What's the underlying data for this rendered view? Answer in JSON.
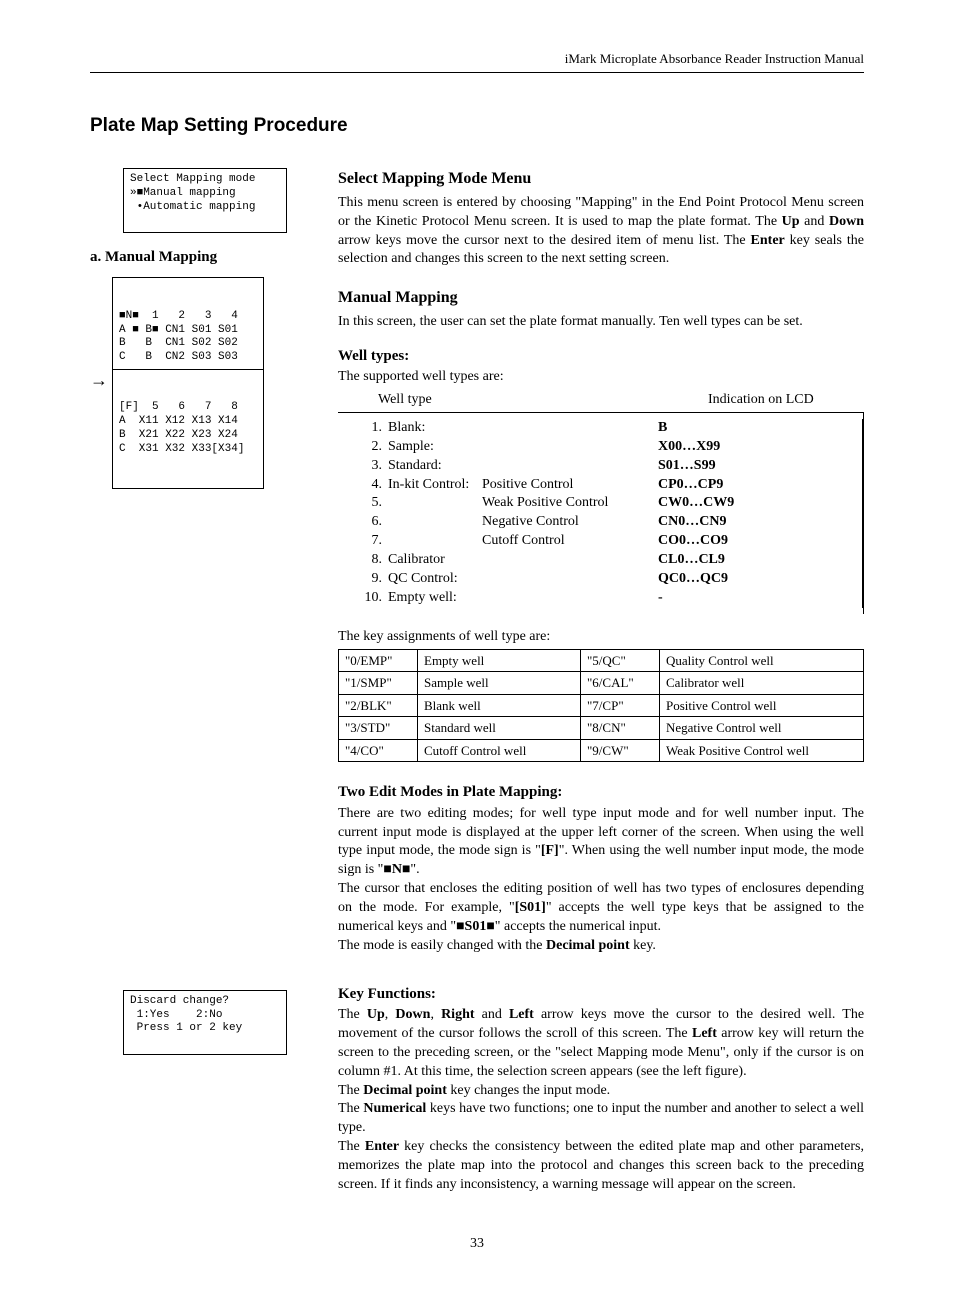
{
  "header": {
    "doc_title": "iMark Microplate Absorbance Reader Instruction Manual"
  },
  "h1": "Plate Map Setting Procedure",
  "lcd_mapping_mode": "Select Mapping mode\n»■Manual mapping\n •Automatic mapping\n ",
  "a_manual_heading": "a. Manual Mapping",
  "lcd_manual_top": "■N■  1   2   3   4\nA ■ B■ CN1 S01 S01\nB   B  CN1 S02 S02\nC   B  CN2 S03 S03",
  "lcd_manual_bot": "[F]  5   6   7   8\nA  X11 X12 X13 X14\nB  X21 X22 X23 X24\nC  X31 X32 X33[X34]",
  "lcd_discard": "Discard change?\n 1:Yes    2:No\n Press 1 or 2 key\n ",
  "sec_select": {
    "title": "Select Mapping Mode Menu",
    "body_parts": [
      "This menu screen is entered by choosing \"Mapping\" in the End Point Protocol Menu screen or the Kinetic Protocol Menu screen. It is used to map the plate format. The ",
      "Up",
      " and ",
      "Down",
      " arrow keys move the cursor next to the desired item of menu list. The ",
      "Enter",
      " key seals the selection and changes this screen to the next setting screen."
    ]
  },
  "sec_manual": {
    "title": "Manual Mapping",
    "intro": "In this screen, the user can set the plate format manually. Ten well types can be set."
  },
  "well_types": {
    "heading": "Well types:",
    "supported": "The supported well types are:",
    "col_a": "Well type",
    "col_b": "Indication on LCD",
    "rows": [
      {
        "n": "1.",
        "name": "Blank:",
        "desc": "",
        "ind": "B"
      },
      {
        "n": "2.",
        "name": "Sample:",
        "desc": "",
        "ind": "X00…X99"
      },
      {
        "n": "3.",
        "name": "Standard:",
        "desc": "",
        "ind": "S01…S99"
      },
      {
        "n": "4.",
        "name": "In-kit Control:",
        "desc": "Positive Control",
        "ind": "CP0…CP9"
      },
      {
        "n": "5.",
        "name": "",
        "desc": "Weak Positive Control",
        "ind": "CW0…CW9"
      },
      {
        "n": "6.",
        "name": "",
        "desc": "Negative Control",
        "ind": "CN0…CN9"
      },
      {
        "n": "7.",
        "name": "",
        "desc": "Cutoff Control",
        "ind": "CO0…CO9"
      },
      {
        "n": "8.",
        "name": "Calibrator",
        "desc": "",
        "ind": "CL0…CL9"
      },
      {
        "n": "9.",
        "name": "QC Control:",
        "desc": "",
        "ind": "QC0…QC9"
      },
      {
        "n": "10.",
        "name": "Empty well:",
        "desc": "",
        "ind": "-"
      }
    ]
  },
  "key_intro": "The key assignments of well type are:",
  "key_table": [
    {
      "k1": "\"0/EMP\"",
      "d1": "Empty well",
      "k2": "\"5/QC\"",
      "d2": "Quality Control well"
    },
    {
      "k1": "\"1/SMP\"",
      "d1": "Sample well",
      "k2": "\"6/CAL\"",
      "d2": "Calibrator well"
    },
    {
      "k1": "\"2/BLK\"",
      "d1": "Blank well",
      "k2": "\"7/CP\"",
      "d2": "Positive Control well"
    },
    {
      "k1": "\"3/STD\"",
      "d1": "Standard well",
      "k2": "\"8/CN\"",
      "d2": "Negative Control well"
    },
    {
      "k1": "\"4/CO\"",
      "d1": "Cutoff Control well",
      "k2": "\"9/CW\"",
      "d2": "Weak Positive Control well"
    }
  ],
  "two_modes": {
    "heading": "Two Edit Modes in Plate Mapping:",
    "p1_parts": [
      "There are two editing modes; for well type input mode and for well number input. The current input mode is displayed at the upper left corner of the screen. When using the well type input mode, the mode sign is \"",
      "[F]",
      "\". When using the well number input mode, the mode sign is \"",
      "■N■",
      "\"."
    ],
    "p2_parts": [
      "The cursor that encloses the editing position of well has two types of enclosures depending on the mode. For example, \"",
      "[S01]",
      "\" accepts the well type keys that be assigned to the numerical keys and \"",
      "■S01■",
      "\" accepts the numerical input."
    ],
    "p3_parts": [
      "The mode is easily changed with the ",
      "Decimal point",
      " key."
    ]
  },
  "key_funcs": {
    "heading": "Key Functions:",
    "p1_parts": [
      "The ",
      "Up",
      ", ",
      "Down",
      ", ",
      "Right",
      " and ",
      "Left",
      " arrow keys move the cursor to the desired well. The movement of the cursor follows the scroll of this screen. The ",
      "Left",
      " arrow key will return the screen to the preceding screen, or the \"select Mapping mode Menu\", only if the cursor is on column #1. At this time, the selection screen appears (see the left figure)."
    ],
    "p2_parts": [
      "The ",
      "Decimal point",
      " key changes the input mode."
    ],
    "p3_parts": [
      "The ",
      "Numerical",
      " keys have two functions; one to input the number and another to select a well type."
    ],
    "p4_parts": [
      "The ",
      "Enter",
      " key checks the consistency between the edited plate map and other parameters, memorizes the plate map into the protocol and changes this screen back to the preceding screen. If it finds any inconsistency, a warning message will appear on the screen."
    ]
  },
  "page_number": "33"
}
